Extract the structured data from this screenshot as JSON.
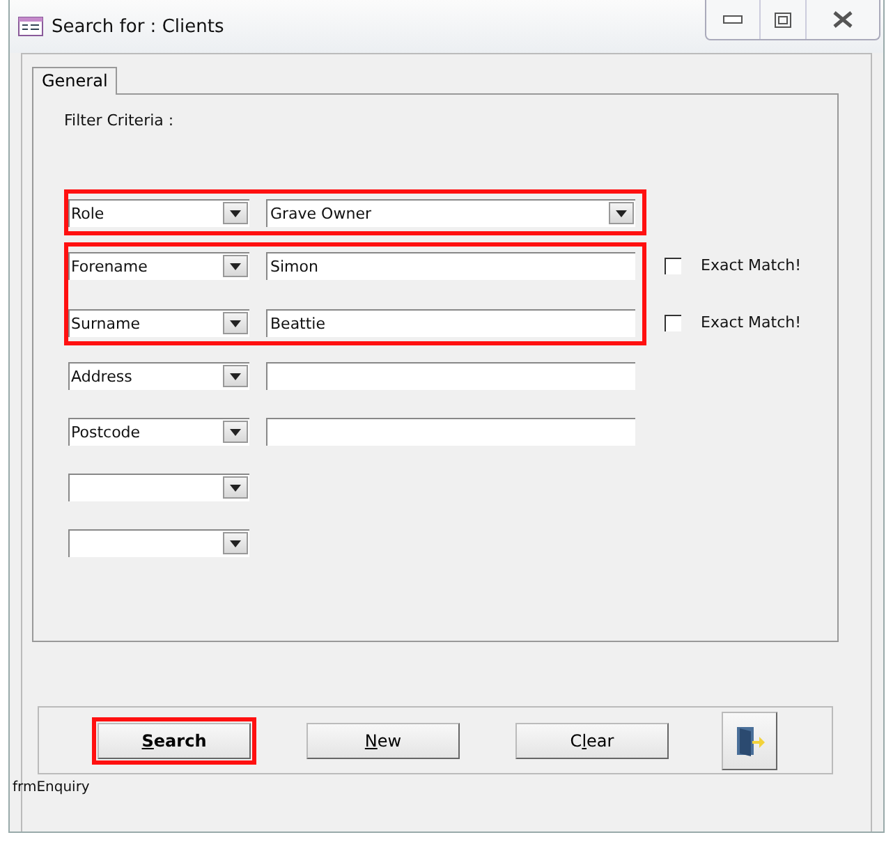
{
  "window": {
    "title": "Search for : Clients"
  },
  "tabs": [
    {
      "label": "General",
      "selected": true
    }
  ],
  "filter_heading": "Filter Criteria :",
  "groups": [
    {
      "highlighted": true,
      "rows": [
        {
          "kind": "combo",
          "field": "Role",
          "value": "Grave Owner"
        }
      ]
    },
    {
      "highlighted": true,
      "rows": [
        {
          "kind": "text",
          "field": "Forename",
          "value": "Simon",
          "exact_match": {
            "label": "Exact Match!",
            "checked": false
          }
        },
        {
          "kind": "text",
          "field": "Surname",
          "value": "Beattie",
          "exact_match": {
            "label": "Exact Match!",
            "checked": false
          }
        }
      ]
    },
    {
      "highlighted": false,
      "rows": [
        {
          "kind": "text",
          "field": "Address"
        },
        {
          "kind": "text",
          "field": "Postcode"
        },
        {
          "kind": "selector"
        },
        {
          "kind": "selector"
        }
      ]
    }
  ],
  "buttons": [
    {
      "kind": "text",
      "access_key": "S",
      "label_rest": "earch",
      "highlighted": true
    },
    {
      "kind": "text",
      "access_key": "N",
      "label_rest": "ew",
      "highlighted": false
    },
    {
      "kind": "text",
      "label_start": "C",
      "access_key": "l",
      "label_rest": "ear",
      "highlighted": false
    },
    {
      "kind": "exit"
    }
  ],
  "form_name": "frmEnquiry"
}
